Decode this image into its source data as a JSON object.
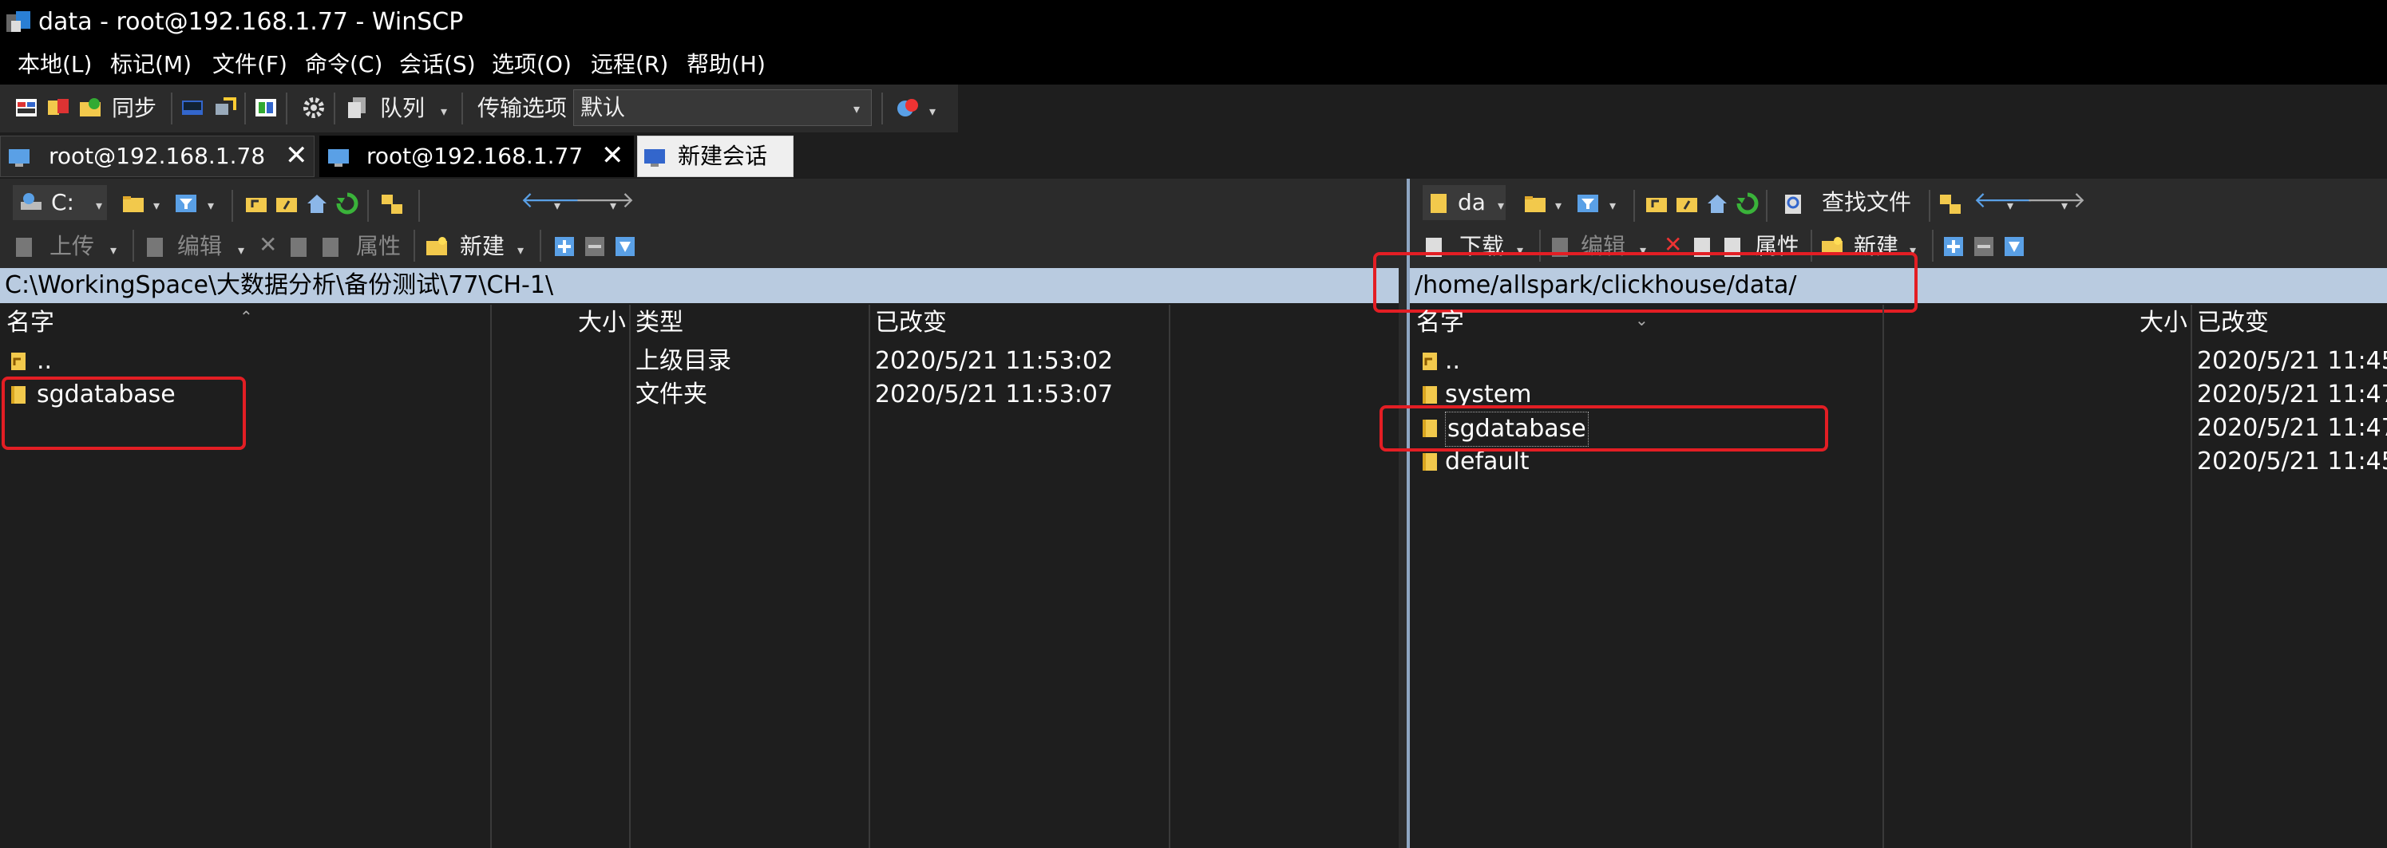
{
  "window": {
    "title": "data - root@192.168.1.77 - WinSCP"
  },
  "menu": [
    "本地(L)",
    "标记(M)",
    "文件(F)",
    "命令(C)",
    "会话(S)",
    "选项(O)",
    "远程(R)",
    "帮助(H)"
  ],
  "toolbar": {
    "sync_label": "同步",
    "queue_label": "队列",
    "transfer_options_label": "传输选项",
    "transfer_preset": "默认"
  },
  "tabs": [
    {
      "label": "root@192.168.1.78",
      "close": "✕"
    },
    {
      "label": "root@192.168.1.77",
      "close": "✕"
    },
    {
      "label": "新建会话"
    }
  ],
  "local": {
    "drive": "C:",
    "actions": {
      "upload": "上传",
      "edit": "编辑",
      "properties": "属性",
      "new": "新建"
    },
    "path": "C:\\WorkingSpace\\大数据分析\\备份测试\\77\\CH-1\\",
    "columns": {
      "name": "名字",
      "size": "大小",
      "type": "类型",
      "modified": "已改变"
    },
    "rows": [
      {
        "name": "..",
        "type": "上级目录",
        "modified": "2020/5/21  11:53:02"
      },
      {
        "name": "sgdatabase",
        "type": "文件夹",
        "modified": "2020/5/21  11:53:07"
      }
    ]
  },
  "remote": {
    "folder": "da",
    "find_files": "查找文件",
    "actions": {
      "download": "下载",
      "edit": "编辑",
      "properties": "属性",
      "new": "新建"
    },
    "path": "/home/allspark/clickhouse/data/",
    "columns": {
      "name": "名字",
      "size": "大小",
      "modified": "已改变"
    },
    "rows": [
      {
        "name": "..",
        "modified": "2020/5/21 11:45"
      },
      {
        "name": "system",
        "modified": "2020/5/21 11:47"
      },
      {
        "name": "sgdatabase",
        "modified": "2020/5/21 11:47"
      },
      {
        "name": "default",
        "modified": "2020/5/21 11:45"
      }
    ]
  },
  "colors": {
    "highlight": "#e31e24",
    "path_bar": "#b9cbe0",
    "folder": "#f2c94c"
  }
}
